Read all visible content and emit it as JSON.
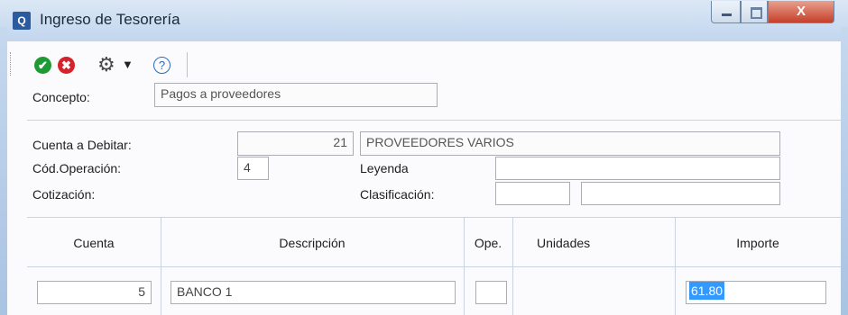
{
  "window": {
    "title": "Ingreso de Tesorería",
    "close_glyph": "X"
  },
  "toolbar": {
    "ok_icon": "check-circle-icon",
    "cancel_icon": "x-circle-icon",
    "gear_icon": "gear-icon",
    "help_icon": "help-circle-icon"
  },
  "form": {
    "concepto_label": "Concepto:",
    "concepto_value": "Pagos a proveedores",
    "cuenta_debitar_label": "Cuenta a Debitar:",
    "cuenta_debitar_code": "21",
    "cuenta_debitar_name": "PROVEEDORES VARIOS",
    "cod_operacion_label": "Cód.Operación:",
    "cod_operacion_value": "4",
    "leyenda_label": "Leyenda",
    "leyenda_value": "",
    "cotizacion_label": "Cotización:",
    "clasificacion_label": "Clasificación:",
    "clasificacion_value1": "",
    "clasificacion_value2": ""
  },
  "grid": {
    "columns": [
      "Cuenta",
      "Descripción",
      "Ope.",
      "Unidades",
      "Importe"
    ],
    "rows": [
      {
        "cuenta": "5",
        "descripcion": "BANCO 1",
        "ope": "",
        "unidades": "",
        "importe": "61.80"
      }
    ]
  },
  "colors": {
    "titlebar": "#c2d6ee",
    "selection": "#3399ff",
    "ok": "#1e9a34",
    "cancel": "#d4232b"
  }
}
